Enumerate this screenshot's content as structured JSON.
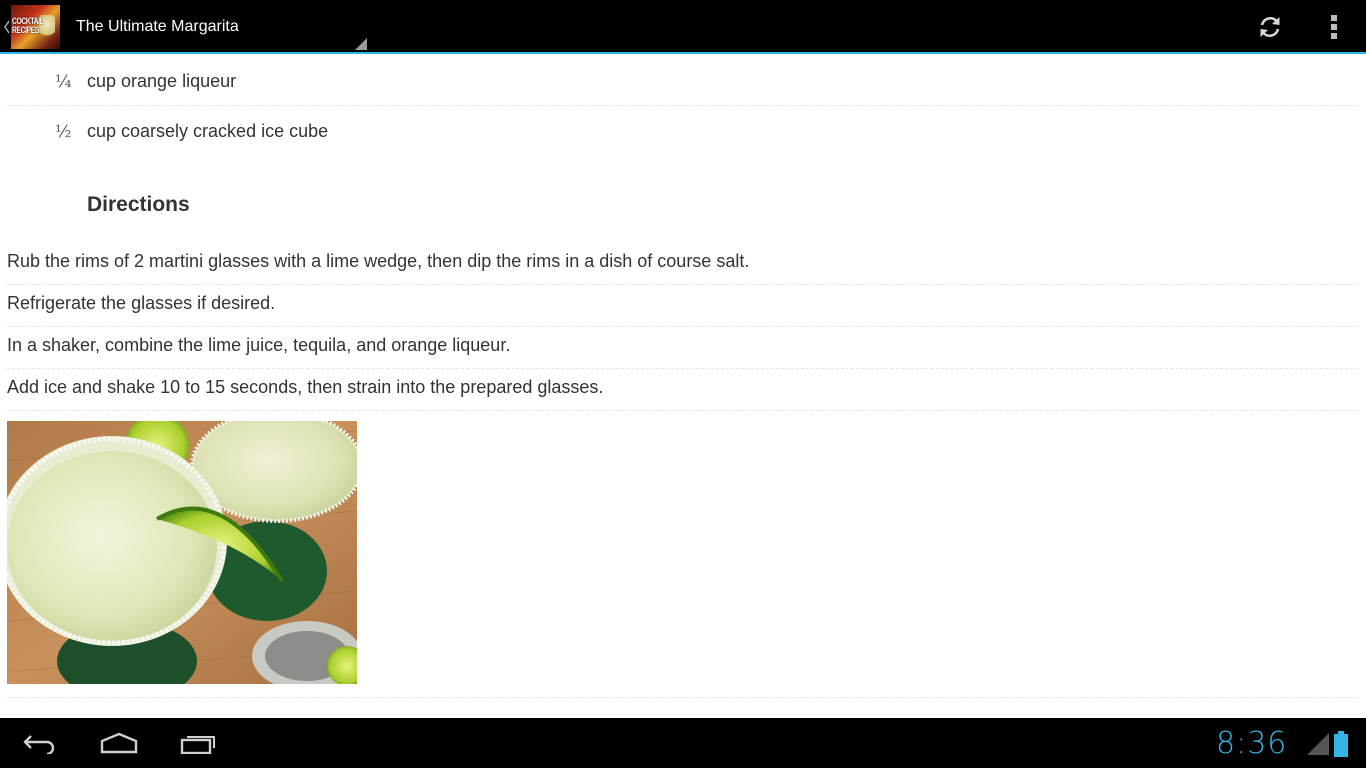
{
  "action_bar": {
    "title": "The Ultimate Margarita",
    "app_icon_text": "COCKTAIL RECIPES",
    "accent_color": "#33b5e5",
    "icons": [
      "up-caret-icon",
      "refresh-icon",
      "overflow-menu-icon"
    ]
  },
  "ingredients": [
    {
      "qty": "¼",
      "text": "cup orange liqueur"
    },
    {
      "qty": "½",
      "text": "cup coarsely cracked ice cube"
    }
  ],
  "directions": {
    "heading": "Directions",
    "steps": [
      "Rub the rims of 2 martini glasses with a lime wedge, then dip the rims in a dish of course salt.",
      "Refrigerate the glasses if desired.",
      "In a shaker, combine the lime juice, tequila, and orange liqueur.",
      "Add ice and shake 10 to 15 seconds, then strain into the prepared glasses."
    ]
  },
  "photo": {
    "subject": "margarita-photo"
  },
  "system_bar": {
    "time": "8:36",
    "clock_color": "#33b5e5",
    "icons": [
      "back-icon",
      "home-icon",
      "recent-apps-icon",
      "signal-icon",
      "battery-icon"
    ]
  }
}
